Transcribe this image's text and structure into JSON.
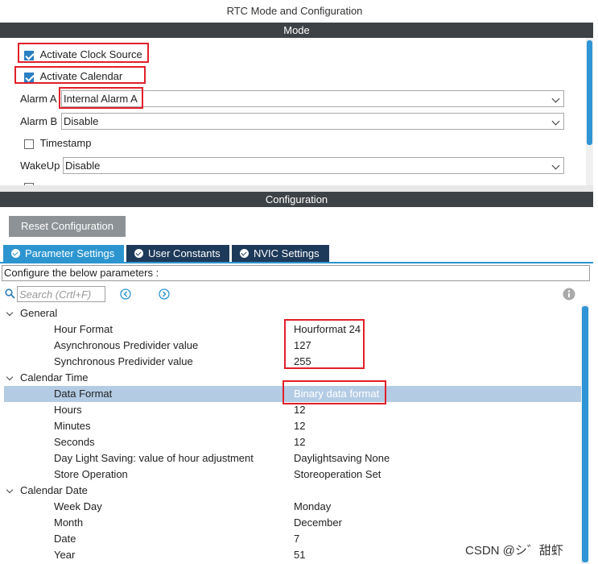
{
  "window_title": "RTC Mode and Configuration",
  "mode": {
    "header": "Mode",
    "activate_clock_source": {
      "label": "Activate Clock Source",
      "checked": true
    },
    "activate_calendar": {
      "label": "Activate Calendar",
      "checked": true
    },
    "alarm_a": {
      "label": "Alarm A",
      "value": "Internal Alarm A"
    },
    "alarm_b": {
      "label": "Alarm B",
      "value": "Disable"
    },
    "timestamp": {
      "label": "Timestamp",
      "checked": false
    },
    "wakeup": {
      "label": "WakeUp",
      "value": "Disable"
    }
  },
  "configuration": {
    "header": "Configuration",
    "reset_button": "Reset Configuration",
    "tabs": [
      {
        "label": "Parameter Settings",
        "active": true
      },
      {
        "label": "User Constants",
        "active": false
      },
      {
        "label": "NVIC Settings",
        "active": false
      }
    ],
    "hint": "Configure the below parameters :",
    "search_placeholder": "Search (Crtl+F)",
    "groups": [
      {
        "name": "General",
        "params": [
          {
            "name": "Hour Format",
            "value": "Hourformat 24"
          },
          {
            "name": "Asynchronous Predivider value",
            "value": "127"
          },
          {
            "name": "Synchronous Predivider value",
            "value": "255"
          }
        ]
      },
      {
        "name": "Calendar Time",
        "params": [
          {
            "name": "Data Format",
            "value": "Binary data format"
          },
          {
            "name": "Hours",
            "value": "12"
          },
          {
            "name": "Minutes",
            "value": "12"
          },
          {
            "name": "Seconds",
            "value": "12"
          },
          {
            "name": "Day Light Saving: value of hour adjustment",
            "value": "Daylightsaving None"
          },
          {
            "name": "Store Operation",
            "value": "Storeoperation Set"
          }
        ]
      },
      {
        "name": "Calendar Date",
        "params": [
          {
            "name": "Week Day",
            "value": "Monday"
          },
          {
            "name": "Month",
            "value": "December"
          },
          {
            "name": "Date",
            "value": "7"
          },
          {
            "name": "Year",
            "value": "51"
          }
        ]
      }
    ]
  },
  "watermark": "CSDN @シ゛甜虾",
  "colors": {
    "accent": "#2c95d0",
    "dark_bar": "#3d4246",
    "highlight": "#e0202a",
    "selected_row": "#b3cce4"
  }
}
